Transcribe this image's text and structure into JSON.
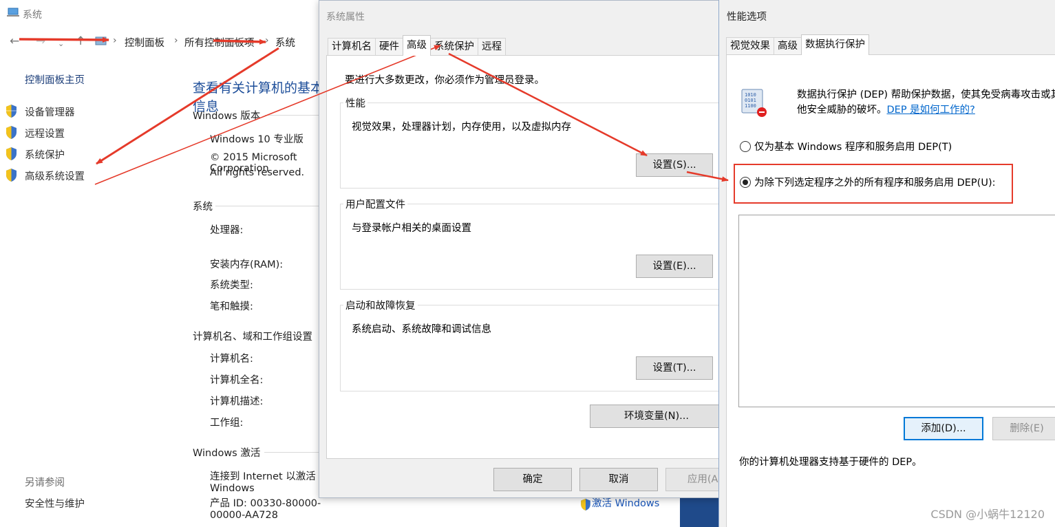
{
  "system_window": {
    "title": "系统",
    "breadcrumb": [
      "控制面板",
      "所有控制面板项",
      "系统"
    ],
    "sidebar": {
      "home": "控制面板主页",
      "items": [
        {
          "label": "设备管理器",
          "icon": "uac-shield-icon"
        },
        {
          "label": "远程设置",
          "icon": "uac-shield-icon"
        },
        {
          "label": "系统保护",
          "icon": "uac-shield-icon"
        },
        {
          "label": "高级系统设置",
          "icon": "uac-shield-icon"
        }
      ],
      "see_also_title": "另请参阅",
      "see_also_items": [
        "安全性与维护"
      ]
    },
    "heading": "查看有关计算机的基本信息",
    "windows_edition": {
      "section": "Windows 版本",
      "edition": "Windows 10 专业版",
      "copyright": "© 2015 Microsoft Corporation",
      "rights": "All rights reserved."
    },
    "system_section": {
      "section": "系统",
      "labels": [
        "处理器:",
        "安装内存(RAM):",
        "系统类型:",
        "笔和触摸:"
      ]
    },
    "computer_section": {
      "section": "计算机名、域和工作组设置",
      "labels": [
        "计算机名:",
        "计算机全名:",
        "计算机描述:",
        "工作组:"
      ]
    },
    "activation_section": {
      "section": "Windows 激活",
      "status": "连接到 Internet 以激活 Windows",
      "product_id": "产品 ID: 00330-80000-00000-AA728",
      "activate_link": "激活 Windows"
    }
  },
  "system_properties": {
    "title": "系统属性",
    "tabs": [
      "计算机名",
      "硬件",
      "高级",
      "系统保护",
      "远程"
    ],
    "active_tab": "高级",
    "admin_note": "要进行大多数更改，你必须作为管理员登录。",
    "performance": {
      "title": "性能",
      "desc": "视觉效果，处理器计划，内存使用，以及虚拟内存",
      "button": "设置(S)..."
    },
    "user_profiles": {
      "title": "用户配置文件",
      "desc": "与登录帐户相关的桌面设置",
      "button": "设置(E)..."
    },
    "startup_recovery": {
      "title": "启动和故障恢复",
      "desc": "系统启动、系统故障和调试信息",
      "button": "设置(T)..."
    },
    "env_button": "环境变量(N)...",
    "ok": "确定",
    "cancel": "取消",
    "apply": "应用(A)"
  },
  "performance_options": {
    "title": "性能选项",
    "tabs": [
      "视觉效果",
      "高级",
      "数据执行保护"
    ],
    "active_tab": "数据执行保护",
    "dep_desc_line1": "数据执行保护 (DEP) 帮助保护数据，使其免受病毒攻击或其",
    "dep_desc_line2": "他安全威胁的破坏。",
    "dep_link": "DEP 是如何工作的?",
    "option_basic": "仅为基本 Windows 程序和服务启用 DEP(T)",
    "option_all": "为除下列选定程序之外的所有程序和服务启用 DEP(U):",
    "selected_option": "option_all",
    "add_button": "添加(D)...",
    "remove_button": "删除(E)",
    "hw_support": "你的计算机处理器支持基于硬件的 DEP。"
  },
  "watermark": "CSDN @小蜗牛12120",
  "colors": {
    "annotation_red": "#e53a2a",
    "link_blue": "#0066cc",
    "heading_blue": "#1c4d99",
    "dialog_bg": "#f0f0f0"
  }
}
